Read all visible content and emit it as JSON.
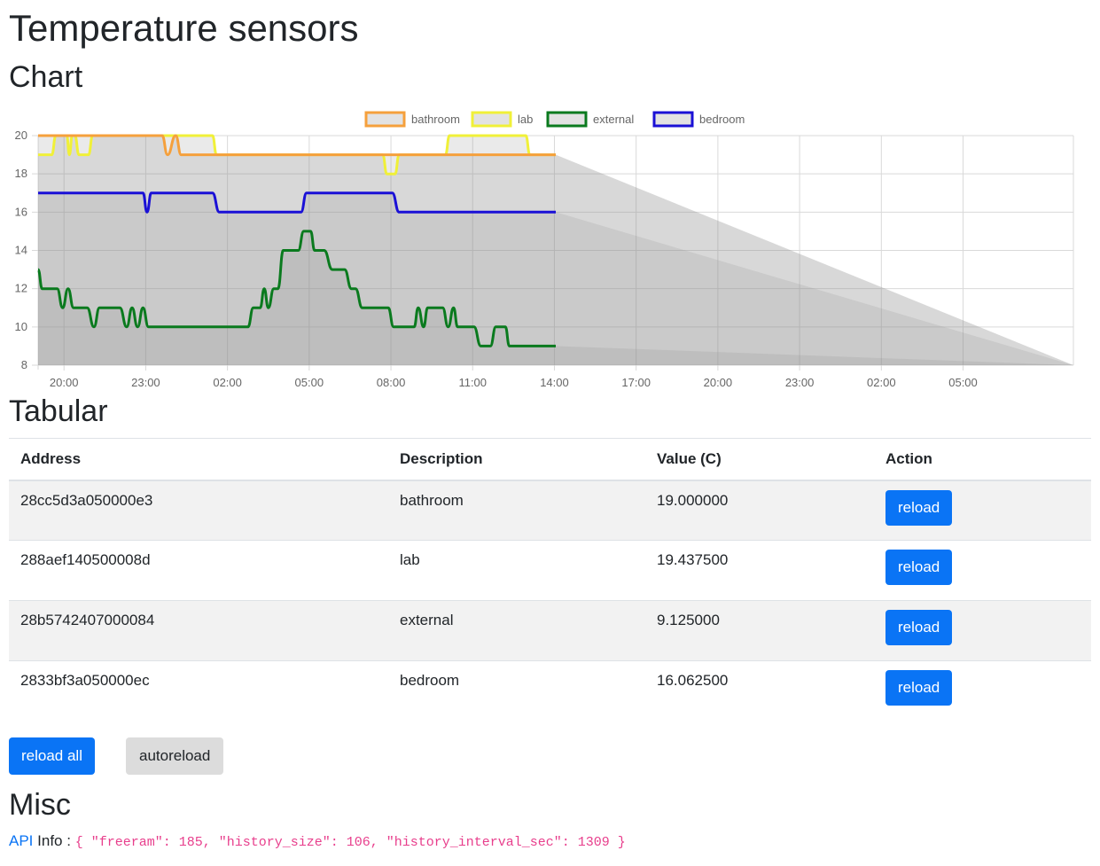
{
  "page": {
    "title": "Temperature sensors"
  },
  "sections": {
    "chart": "Chart",
    "tabular": "Tabular",
    "misc": "Misc"
  },
  "chart_data": {
    "type": "area",
    "x_tick_labels": [
      "20:00",
      "23:00",
      "02:00",
      "05:00",
      "08:00",
      "11:00",
      "14:00",
      "17:00",
      "20:00",
      "23:00",
      "02:00",
      "05:00"
    ],
    "x": [
      "17:17",
      "18:00",
      "18:30",
      "19:00",
      "19:30",
      "20:00",
      "20:30",
      "21:00",
      "21:30",
      "22:00",
      "22:30",
      "23:00",
      "23:30",
      "00:00",
      "00:30",
      "01:00",
      "01:30",
      "02:00",
      "02:30",
      "03:00",
      "03:30",
      "04:00",
      "04:30",
      "05:00",
      "05:30",
      "06:00",
      "06:30",
      "07:00",
      "07:30",
      "08:00",
      "08:30",
      "09:00",
      "09:30",
      "10:00",
      "10:30",
      "11:00",
      "11:30",
      "12:00",
      "12:30",
      "13:00",
      "13:30",
      "14:00",
      "14:30",
      "15:00",
      "15:30",
      "16:00",
      "16:30",
      "17:00",
      "17:30",
      "18:00",
      "18:30",
      "19:00",
      "19:30",
      "20:00",
      "20:30",
      "21:00",
      "21:30",
      "22:00",
      "22:30",
      "23:00",
      "23:30",
      "00:00",
      "00:30",
      "01:00",
      "01:30",
      "02:00",
      "02:30",
      "03:00",
      "03:30",
      "04:00",
      "04:30",
      "05:00",
      "05:30",
      "06:00",
      "06:30",
      "07:00",
      "07:30"
    ],
    "yticks": [
      8,
      10,
      12,
      14,
      16,
      18,
      20
    ],
    "ylim": [
      8,
      20
    ],
    "grid": true,
    "legend_position": "top",
    "series": [
      {
        "name": "bathroom",
        "color": "#f5a03c",
        "points": [
          [
            0,
            20
          ],
          [
            9.1,
            20
          ],
          [
            9.5,
            19
          ],
          [
            10.1,
            20
          ],
          [
            10.5,
            19
          ],
          [
            38,
            19
          ]
        ]
      },
      {
        "name": "lab",
        "color": "#f0f038",
        "points": [
          [
            0,
            19
          ],
          [
            1.0,
            19
          ],
          [
            1.3,
            20
          ],
          [
            2.1,
            20
          ],
          [
            2.3,
            19
          ],
          [
            2.5,
            20
          ],
          [
            2.7,
            20
          ],
          [
            3.0,
            19
          ],
          [
            3.7,
            19
          ],
          [
            4.0,
            20
          ],
          [
            12.8,
            20
          ],
          [
            13.1,
            19
          ],
          [
            25.3,
            19
          ],
          [
            25.6,
            18
          ],
          [
            26.2,
            18
          ],
          [
            26.5,
            19
          ],
          [
            29.9,
            19
          ],
          [
            30.2,
            20
          ],
          [
            35.8,
            20
          ],
          [
            36.1,
            19
          ],
          [
            38,
            19
          ]
        ]
      },
      {
        "name": "external",
        "color": "#0a7a1e",
        "points": [
          [
            0,
            13
          ],
          [
            0.3,
            12
          ],
          [
            1.4,
            12
          ],
          [
            1.8,
            11
          ],
          [
            2.2,
            12
          ],
          [
            2.6,
            11
          ],
          [
            3.6,
            11
          ],
          [
            4.1,
            10
          ],
          [
            4.5,
            11
          ],
          [
            6.0,
            11
          ],
          [
            6.5,
            10
          ],
          [
            6.9,
            11
          ],
          [
            7.3,
            10
          ],
          [
            7.7,
            11
          ],
          [
            8.1,
            10
          ],
          [
            15.1,
            10
          ],
          [
            15.4,
            10
          ],
          [
            15.8,
            11
          ],
          [
            16.3,
            11
          ],
          [
            16.6,
            12
          ],
          [
            16.9,
            11
          ],
          [
            17.3,
            12
          ],
          [
            17.6,
            12
          ],
          [
            18.0,
            14
          ],
          [
            19.1,
            14
          ],
          [
            19.5,
            15
          ],
          [
            20.0,
            15
          ],
          [
            20.3,
            14
          ],
          [
            21.0,
            14
          ],
          [
            21.6,
            13
          ],
          [
            22.5,
            13
          ],
          [
            23.0,
            12
          ],
          [
            23.3,
            12
          ],
          [
            23.8,
            11
          ],
          [
            25.7,
            11
          ],
          [
            26.1,
            10
          ],
          [
            27.4,
            10
          ],
          [
            27.6,
            10
          ],
          [
            27.9,
            11
          ],
          [
            28.3,
            10
          ],
          [
            28.6,
            11
          ],
          [
            29.7,
            11
          ],
          [
            30.1,
            10
          ],
          [
            30.5,
            11
          ],
          [
            30.8,
            10
          ],
          [
            32.0,
            10
          ],
          [
            32.5,
            9
          ],
          [
            33.2,
            9
          ],
          [
            33.6,
            10
          ],
          [
            34.3,
            10
          ],
          [
            34.6,
            9
          ],
          [
            38,
            9
          ]
        ]
      },
      {
        "name": "bedroom",
        "color": "#1a10d6",
        "points": [
          [
            0,
            17
          ],
          [
            7.7,
            17
          ],
          [
            8.0,
            16
          ],
          [
            8.3,
            17
          ],
          [
            12.8,
            17
          ],
          [
            13.3,
            16
          ],
          [
            19.3,
            16
          ],
          [
            19.7,
            17
          ],
          [
            26.0,
            17
          ],
          [
            26.5,
            16
          ],
          [
            38,
            16
          ]
        ]
      }
    ]
  },
  "table": {
    "headers": {
      "address": "Address",
      "description": "Description",
      "value": "Value (C)",
      "action": "Action"
    },
    "rows": [
      {
        "address": "28cc5d3a050000e3",
        "description": "bathroom",
        "value": "19.000000",
        "action": "reload"
      },
      {
        "address": "288aef140500008d",
        "description": "lab",
        "value": "19.437500",
        "action": "reload"
      },
      {
        "address": "28b5742407000084",
        "description": "external",
        "value": "9.125000",
        "action": "reload"
      },
      {
        "address": "2833bf3a050000ec",
        "description": "bedroom",
        "value": "16.062500",
        "action": "reload"
      }
    ]
  },
  "buttons": {
    "reload_all": "reload all",
    "autoreload": "autoreload"
  },
  "misc": {
    "api_link": "API",
    "info_label": "Info :",
    "info_json": "{ \"freeram\": 185, \"history_size\": 106, \"history_interval_sec\": 1309 }"
  },
  "colors": {
    "primary": "#0a74f5",
    "code": "#e83e8c"
  }
}
